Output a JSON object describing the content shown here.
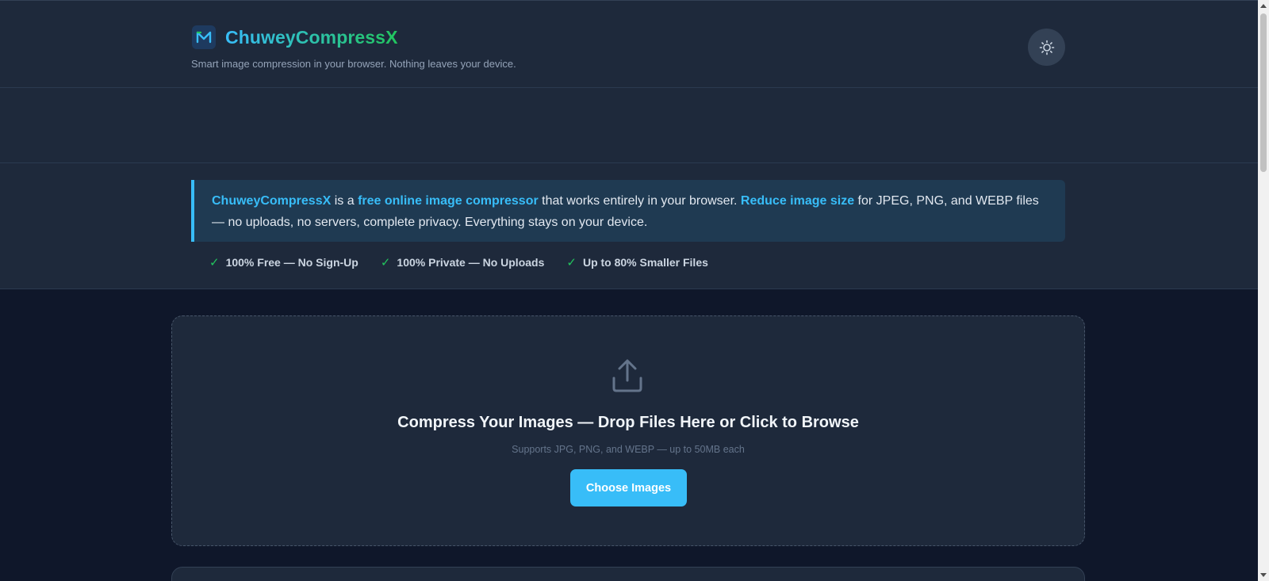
{
  "header": {
    "brand_name": "ChuweyCompressX",
    "tagline": "Smart image compression in your browser. Nothing leaves your device.",
    "theme_toggle_icon": "sun-icon",
    "logo_icon": "logo-icon"
  },
  "intro": {
    "brand": "ChuweyCompressX",
    "text_1": " is a ",
    "highlight_1": "free online image compressor",
    "text_2": " that works entirely in your browser. ",
    "highlight_2": "Reduce image size",
    "text_3": " for JPEG, PNG, and WEBP files — no uploads, no servers, complete privacy. Everything stays on your device.",
    "features": [
      "100% Free — No Sign-Up",
      "100% Private — No Uploads",
      "Up to 80% Smaller Files"
    ]
  },
  "dropzone": {
    "title": "Compress Your Images — Drop Files Here or Click to Browse",
    "subtitle": "Supports JPG, PNG, and WEBP — up to 50MB each",
    "button_label": "Choose Images",
    "icon": "upload-icon"
  },
  "colors": {
    "accent": "#38bdf8",
    "success": "#22c55e",
    "background": "#0f172a",
    "surface": "#1e293b"
  }
}
